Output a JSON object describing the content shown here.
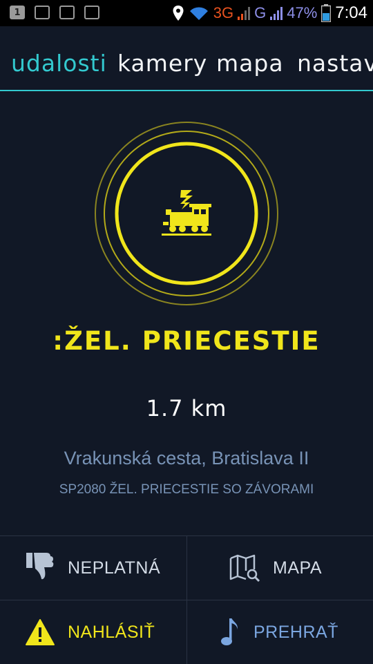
{
  "status_bar": {
    "notif_badge": "1",
    "network_3g": "3G",
    "network_g": "G",
    "battery": "47%",
    "time": "7:04"
  },
  "tabs": [
    {
      "label": "udalosti",
      "active": true
    },
    {
      "label": "kamery",
      "active": false
    },
    {
      "label": "mapa",
      "active": false
    },
    {
      "label": "nastav",
      "active": false
    }
  ],
  "event": {
    "icon": "train-crossing-icon",
    "title": ":ŽEL. PRIECESTIE",
    "distance": "1.7 km",
    "address": "Vrakunská cesta, Bratislava II",
    "description": "SP2080 ŽEL. PRIECESTIE SO ZÁVORAMI"
  },
  "actions": {
    "invalid_label": "NEPLATNÁ",
    "map_label": "MAPA",
    "report_label": "NAHLÁSIŤ",
    "play_label": "PREHRAŤ"
  },
  "colors": {
    "background": "#111826",
    "accent": "#33c9cf",
    "warning": "#f0e51b",
    "muted_blue": "#7893b6"
  }
}
